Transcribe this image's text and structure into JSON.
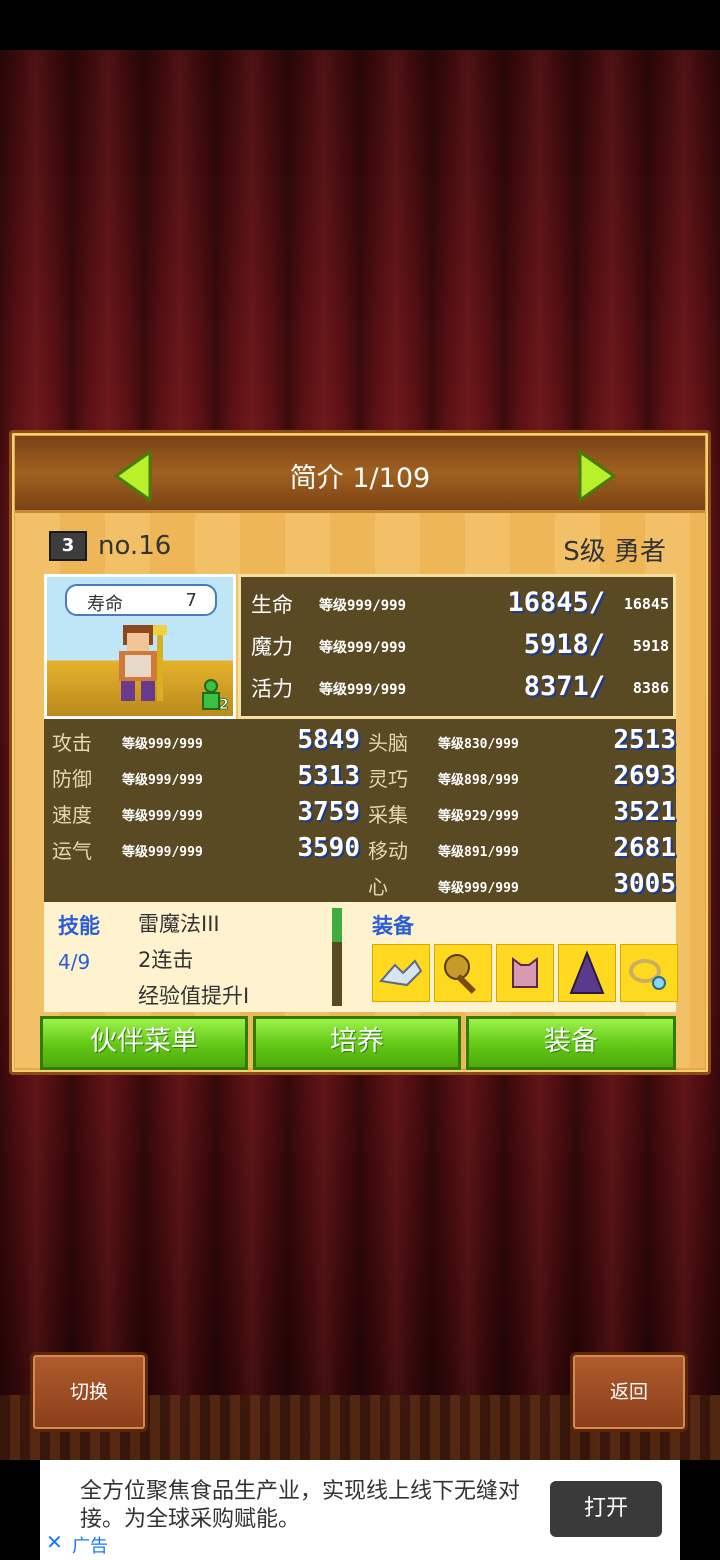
{
  "header": {
    "title": "简介 1/109"
  },
  "character": {
    "id": "no.16",
    "id_icon": "3",
    "rank": "S级 勇者",
    "life_label": "寿命",
    "life_value": "7"
  },
  "vitals": [
    {
      "label": "生命",
      "level": "等级999/999",
      "current": "16845/",
      "max": "16845"
    },
    {
      "label": "魔力",
      "level": "等级999/999",
      "current": "5918/",
      "max": "5918"
    },
    {
      "label": "活力",
      "level": "等级999/999",
      "current": "8371/",
      "max": "8386"
    }
  ],
  "stats_left": [
    {
      "label": "攻击",
      "level": "等级999/999",
      "value": "5849"
    },
    {
      "label": "防御",
      "level": "等级999/999",
      "value": "5313"
    },
    {
      "label": "速度",
      "level": "等级999/999",
      "value": "3759"
    },
    {
      "label": "运气",
      "level": "等级999/999",
      "value": "3590"
    }
  ],
  "stats_right": [
    {
      "label": "头脑",
      "level": "等级830/999",
      "value": "2513"
    },
    {
      "label": "灵巧",
      "level": "等级898/999",
      "value": "2693"
    },
    {
      "label": "采集",
      "level": "等级929/999",
      "value": "3521"
    },
    {
      "label": "移动",
      "level": "等级891/999",
      "value": "2681"
    },
    {
      "label": "心",
      "level": "等级999/999",
      "value": "3005"
    }
  ],
  "skills": {
    "title": "技能",
    "count": "4/9",
    "items": [
      "雷魔法III",
      "2连击",
      "经验值提升I"
    ]
  },
  "equipment": {
    "title": "装备",
    "slots": [
      "wing-icon",
      "mace-icon",
      "armor-icon",
      "cloak-icon",
      "ring-icon"
    ]
  },
  "buttons": {
    "party_menu": "伙伴菜单",
    "train": "培养",
    "equip": "装备"
  },
  "bottom": {
    "switch": "切换",
    "back": "返回"
  },
  "ad": {
    "text": "全方位聚焦食品生产业，实现线上线下无缝对接。为全球采购赋能。",
    "open": "打开",
    "close": "✕",
    "label": "广告"
  },
  "colors": {
    "accent_green": "#62c714",
    "panel": "#e7a640",
    "stat_blue": "#1c3b8e"
  }
}
